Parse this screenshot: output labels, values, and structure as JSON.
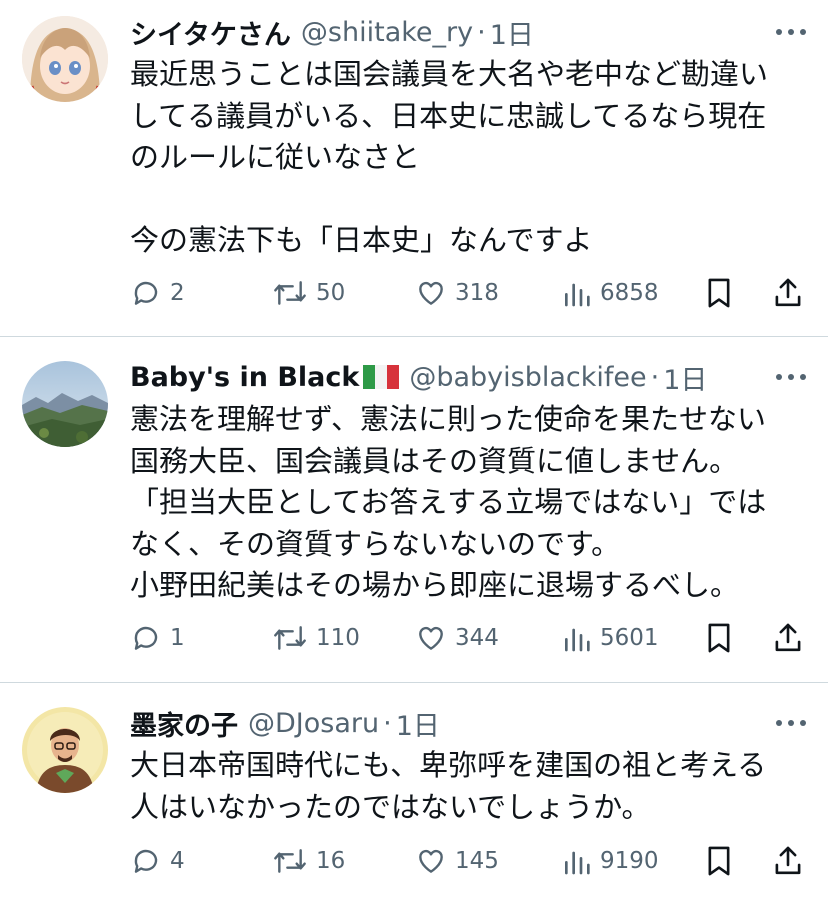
{
  "tweets": [
    {
      "name": "シイタケさん",
      "handle": "@shiitake_ry",
      "separator": "·",
      "time": "1日",
      "avatar_icon": "anime-girl-avatar",
      "lines": [
        "最近思うことは国会議員を大名や老中など勘違い",
        "してる議員がいる、日本史に忠誠してるなら現在",
        "のルールに従いなさと",
        "",
        "今の憲法下も「日本史」なんですよ"
      ],
      "replies": "2",
      "retweets": "50",
      "likes": "318",
      "views": "6858"
    },
    {
      "name": "Baby's in Black",
      "name_emoji": "italy-flag",
      "handle": "@babyisblackifee",
      "separator": "·",
      "time": "1日",
      "avatar_icon": "mountain-landscape-avatar",
      "lines": [
        "憲法を理解せず、憲法に則った使命を果たせない",
        "国務大臣、国会議員はその資質に値しません。",
        "「担当大臣としてお答えする立場ではない」では",
        "なく、その資質すらないないのです。",
        "小野田紀美はその場から即座に退場するべし。"
      ],
      "replies": "1",
      "retweets": "110",
      "likes": "344",
      "views": "5601"
    },
    {
      "name": "墨家の子",
      "handle": "@DJosaru",
      "separator": "·",
      "time": "1日",
      "avatar_icon": "cartoon-man-avatar",
      "lines": [
        "大日本帝国時代にも、卑弥呼を建国の祖と考える",
        "人はいなかったのではないでしょうか。"
      ],
      "replies": "4",
      "retweets": "16",
      "likes": "145",
      "views": "9190"
    }
  ],
  "colors": {
    "text": "#0f1419",
    "secondary": "#536471",
    "divider": "#cfd9de"
  }
}
